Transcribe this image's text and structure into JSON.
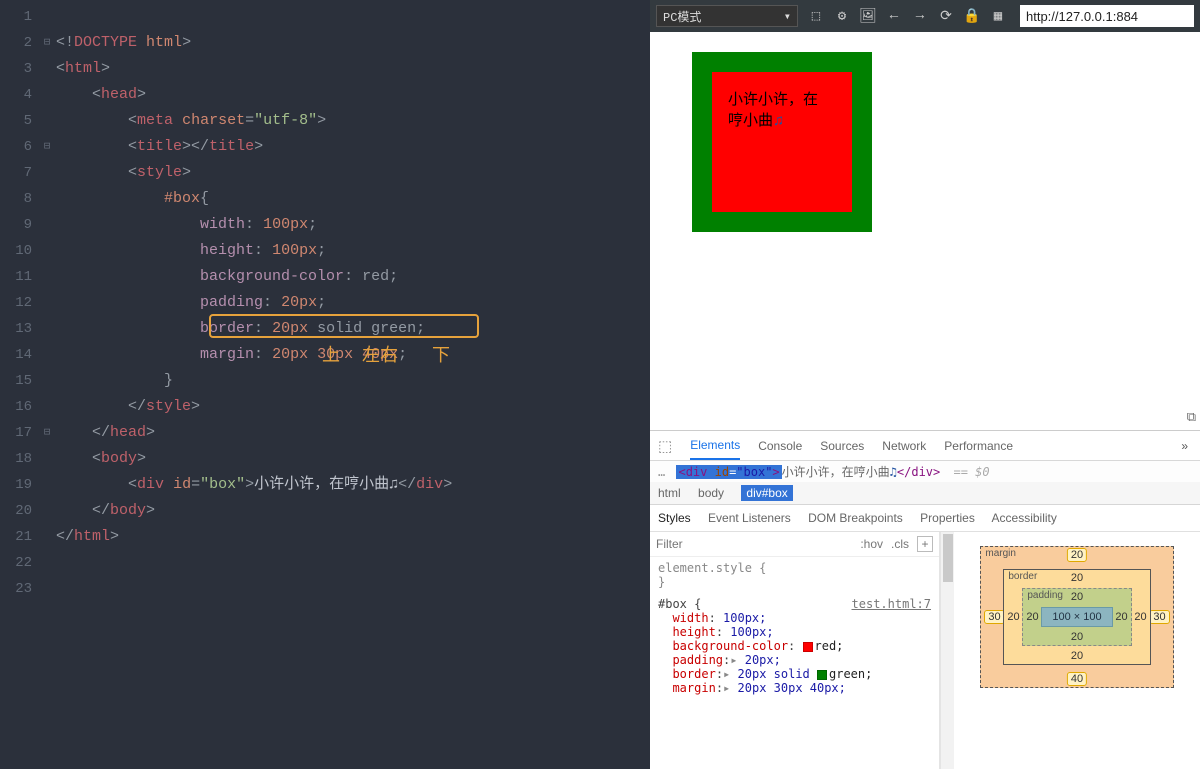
{
  "editor": {
    "lines": 23,
    "fold_at": [
      2,
      6,
      17
    ],
    "code_text_for_box": "小许小许，在哼小曲",
    "highlight": "margin: 20px 30px 40px;",
    "annotation_parts": {
      "top": "上",
      "lr": "左右",
      "bottom": "下"
    }
  },
  "code_tokens": {
    "doctype": "<!DOCTYPE html>",
    "html_open": "<html>",
    "head_open": "<head>",
    "meta": {
      "open": "<meta ",
      "attr": "charset",
      "val": "\"utf-8\"",
      "close": ">"
    },
    "title": "<title></title>",
    "style_open": "<style>",
    "sel": "#box{",
    "p_width": {
      "p": "width",
      "v": "100px"
    },
    "p_height": {
      "p": "height",
      "v": "100px"
    },
    "p_bg": {
      "p": "background-color",
      "v": "red"
    },
    "p_pad": {
      "p": "padding",
      "v": "20px"
    },
    "p_border": {
      "p": "border",
      "n": "20px",
      "rest": "solid green"
    },
    "p_margin": {
      "p": "margin",
      "v": "20px 30px 40px"
    },
    "brace_close": "}",
    "style_close": "</style>",
    "head_close": "</head>",
    "body_open": "<body>",
    "div": {
      "open": "<div ",
      "attr": "id",
      "val": "\"box\"",
      "mid": ">",
      "text": "小许小许，在哼小曲",
      "music": "♫",
      "close": "</div>"
    },
    "body_close": "</body>",
    "html_close": "</html>"
  },
  "toolbar": {
    "mode": "PC模式",
    "url": "http://127.0.0.1:884",
    "icons": [
      "⬚",
      "⚙",
      "🖼",
      "←",
      "→",
      "⟳",
      "🔒",
      "▦"
    ]
  },
  "preview": {
    "text_line1": "小许小许，在",
    "text_line2": "哼小曲",
    "music": "♫"
  },
  "devtools": {
    "tabs": [
      "Elements",
      "Console",
      "Sources",
      "Network",
      "Performance"
    ],
    "active_tab": "Elements",
    "dom_path": {
      "before": "<div id=\"box\">",
      "text": "小许小许，在哼小曲",
      "music": "♫",
      "after": "</div>",
      "eq": "== $0"
    },
    "crumbs": [
      "html",
      "body",
      "div#box"
    ],
    "subtabs": [
      "Styles",
      "Event Listeners",
      "DOM Breakpoints",
      "Properties",
      "Accessibility"
    ],
    "filter_placeholder": "Filter",
    "hov": ":hov",
    "cls": ".cls",
    "element_style": "element.style {",
    "rule_selector": "#box {",
    "rule_source": "test.html:7",
    "props": {
      "width": {
        "k": "width",
        "v": "100px;"
      },
      "height": {
        "k": "height",
        "v": "100px;"
      },
      "bg": {
        "k": "background-color",
        "v": "red;"
      },
      "pad": {
        "k": "padding",
        "v": "20px;"
      },
      "border": {
        "k": "border",
        "v": "20px solid",
        "color": "green;"
      },
      "margin": {
        "k": "margin",
        "v": "20px 30px 40px;"
      }
    },
    "boxmodel": {
      "labels": {
        "margin": "margin",
        "border": "border",
        "padding": "padding"
      },
      "margin": {
        "top": "20",
        "right": "30",
        "bottom": "40",
        "left": "30"
      },
      "border": {
        "top": "20",
        "right": "20",
        "bottom": "20",
        "left": "20"
      },
      "padding": {
        "top": "20",
        "right": "20",
        "bottom": "20",
        "left": "20"
      },
      "content": "100 × 100"
    }
  }
}
